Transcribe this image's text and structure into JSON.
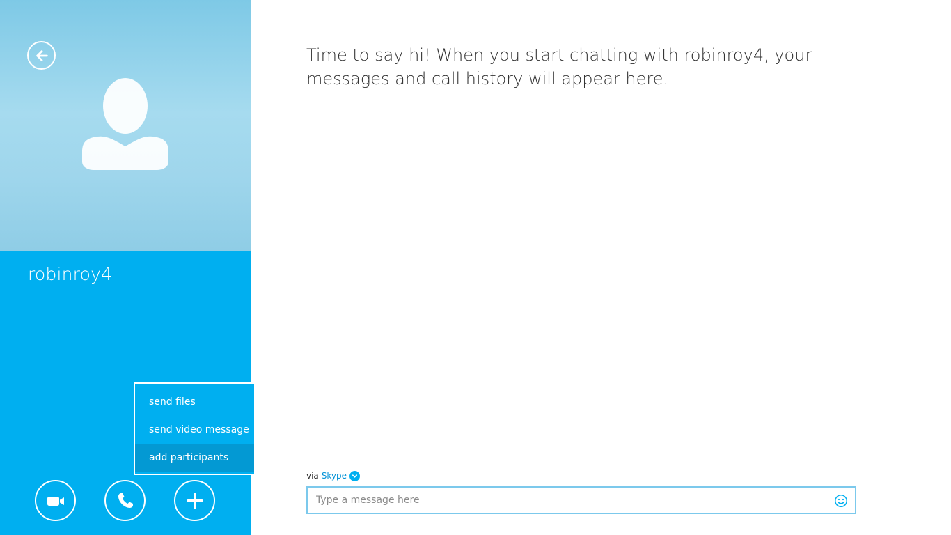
{
  "contact": {
    "name": "robinroy4"
  },
  "chat": {
    "intro_text": "Time to say hi! When you start chatting with robinroy4, your messages and call history will appear here."
  },
  "menu": {
    "items": [
      {
        "label": "send files"
      },
      {
        "label": "send video message"
      },
      {
        "label": "add participants",
        "highlighted": true
      }
    ]
  },
  "compose": {
    "via_label": "via",
    "via_service": "Skype",
    "placeholder": "Type a message here",
    "value": ""
  },
  "icons": {
    "back": "back-arrow-icon",
    "avatar": "person-silhouette-icon",
    "video_call": "video-camera-icon",
    "voice_call": "phone-icon",
    "add": "plus-icon",
    "via_dropdown": "chevron-down-icon",
    "emoticon": "smiley-icon"
  },
  "colors": {
    "accent": "#00aff0",
    "menu_highlight": "#0399d3",
    "link": "#0091d6",
    "input_border": "#7cc9ec",
    "text": "#333333"
  }
}
